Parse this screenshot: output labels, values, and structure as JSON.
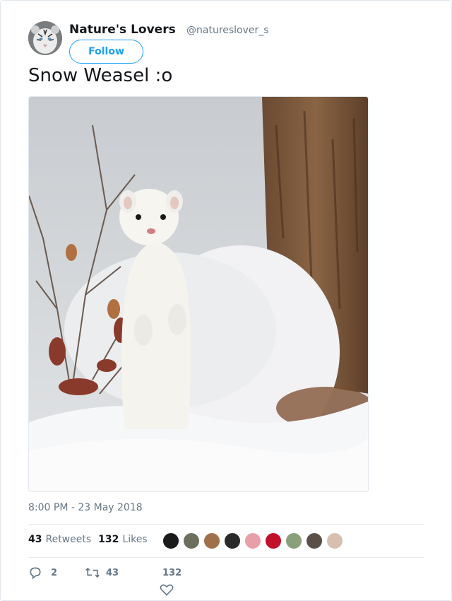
{
  "user": {
    "display_name": "Nature's Lovers",
    "handle": "@natureslover_s",
    "avatar_icon": "white-tiger-avatar"
  },
  "follow_button": {
    "label": "Follow"
  },
  "tweet": {
    "text": "Snow Weasel :o",
    "media_icon": "snow-weasel-photo",
    "timestamp": "8:00 PM - 23 May 2018"
  },
  "stats": {
    "retweets_count": "43",
    "retweets_label": "Retweets",
    "likes_count": "132",
    "likes_label": "Likes"
  },
  "likers": [
    {
      "color": "#1a1a1a"
    },
    {
      "color": "#6b6f5e"
    },
    {
      "color": "#a0704a"
    },
    {
      "color": "#2a2a2a"
    },
    {
      "color": "#e8a0a8"
    },
    {
      "color": "#c0102a"
    },
    {
      "color": "#8aa07a"
    },
    {
      "color": "#5a5048"
    },
    {
      "color": "#d8c0b0"
    }
  ],
  "actions": {
    "reply_count": "2",
    "retweet_count": "43",
    "like_count": "132"
  },
  "colors": {
    "accent": "#1da1f2",
    "secondary_text": "#657786"
  }
}
